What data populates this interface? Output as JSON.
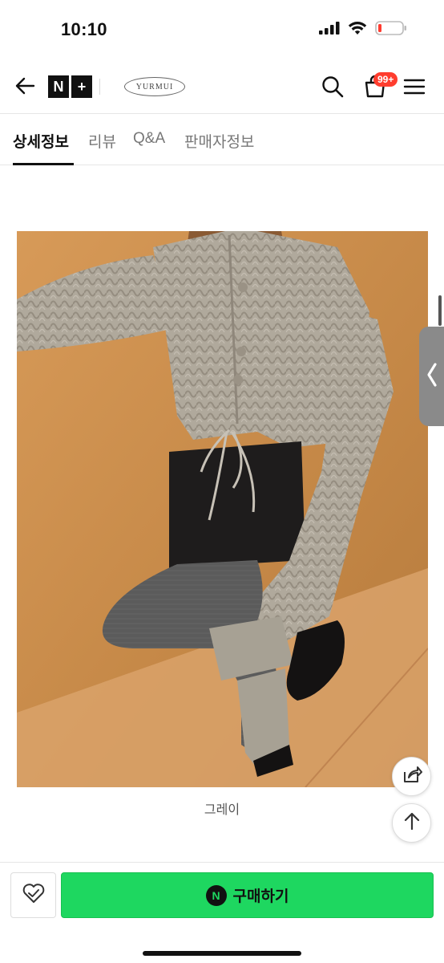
{
  "status_bar": {
    "time": "10:10",
    "icons": [
      "signal-icon",
      "wifi-icon",
      "battery-low-icon"
    ],
    "battery_color": "#ff3b30"
  },
  "header": {
    "back_icon": "arrow-left-icon",
    "nplus_n": "N",
    "nplus_plus": "+",
    "brand_logo_text": "YURMUI",
    "search_icon": "search-icon",
    "cart_icon": "shopping-bag-icon",
    "cart_badge": "99+",
    "cart_badge_color": "#ff3d2e",
    "menu_icon": "hamburger-icon"
  },
  "tabs": [
    {
      "label": "상세정보",
      "active": true
    },
    {
      "label": "리뷰",
      "active": false
    },
    {
      "label": "Q&A",
      "active": false
    },
    {
      "label": "판매자정보",
      "active": false
    }
  ],
  "product": {
    "image_caption": "그레이"
  },
  "floating": {
    "share_icon": "share-icon",
    "top_icon": "arrow-up-icon",
    "side_handle_icon": "chevron-left-icon"
  },
  "bottom_bar": {
    "wish_icon": "heart-check-icon",
    "buy_badge": "N",
    "buy_label": "구매하기",
    "buy_color": "#1ed760"
  }
}
